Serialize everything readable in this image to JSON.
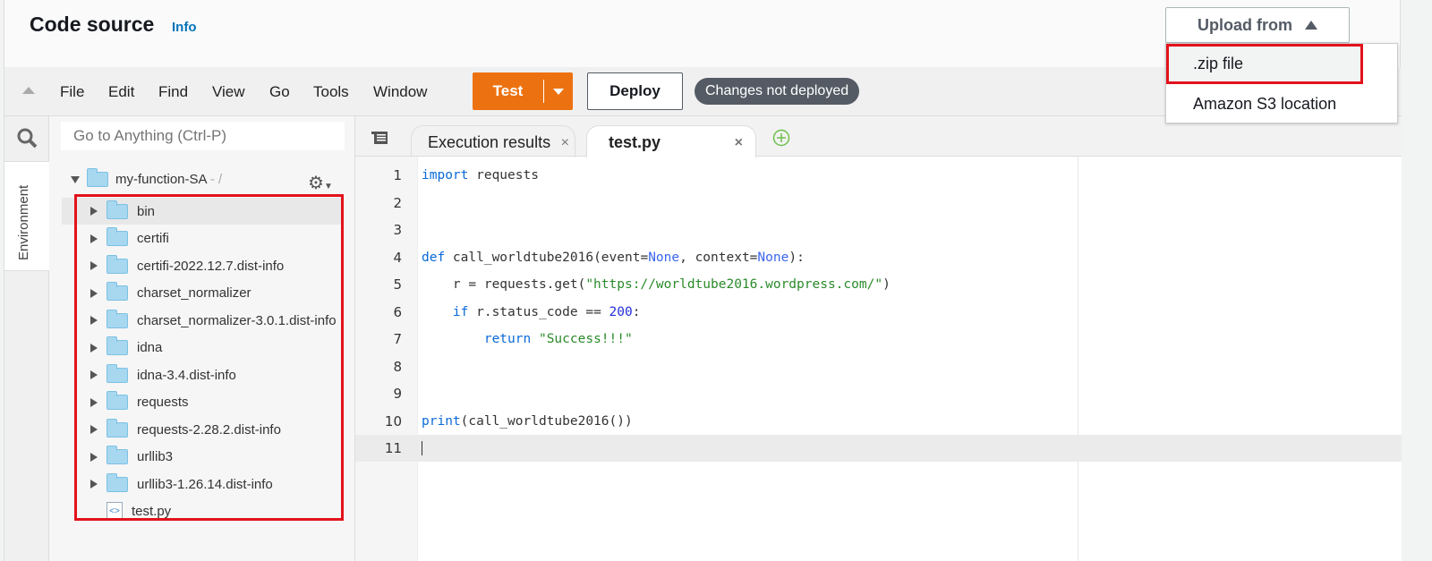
{
  "header": {
    "title": "Code source",
    "info_link": "Info",
    "upload_button": "Upload from",
    "upload_menu": [
      ".zip file",
      "Amazon S3 location"
    ]
  },
  "toolbar": {
    "menus": [
      "File",
      "Edit",
      "Find",
      "View",
      "Go",
      "Tools",
      "Window"
    ],
    "test_label": "Test",
    "deploy_label": "Deploy",
    "status_badge": "Changes not deployed"
  },
  "sidebar": {
    "env_tab": "Environment",
    "search_placeholder": "Go to Anything (Ctrl-P)"
  },
  "tree": {
    "root": "my-function-SA",
    "root_suffix": " - /",
    "folders": [
      "bin",
      "certifi",
      "certifi-2022.12.7.dist-info",
      "charset_normalizer",
      "charset_normalizer-3.0.1.dist-info",
      "idna",
      "idna-3.4.dist-info",
      "requests",
      "requests-2.28.2.dist-info",
      "urllib3",
      "urllib3-1.26.14.dist-info"
    ],
    "files": [
      "test.py"
    ]
  },
  "editor": {
    "tabs": [
      "Execution results",
      "test.py"
    ],
    "active_tab": "test.py",
    "lines": [
      "import requests",
      "",
      "",
      "def call_worldtube2016(event=None, context=None):",
      "    r = requests.get(\"https://worldtube2016.wordpress.com/\")",
      "    if r.status_code == 200:",
      "        return \"Success!!!\"",
      "",
      "",
      "print(call_worldtube2016())",
      ""
    ],
    "current_line": 11
  },
  "colors": {
    "accent": "#ec7211",
    "highlight": "#e3121b",
    "link": "#0073bb"
  }
}
